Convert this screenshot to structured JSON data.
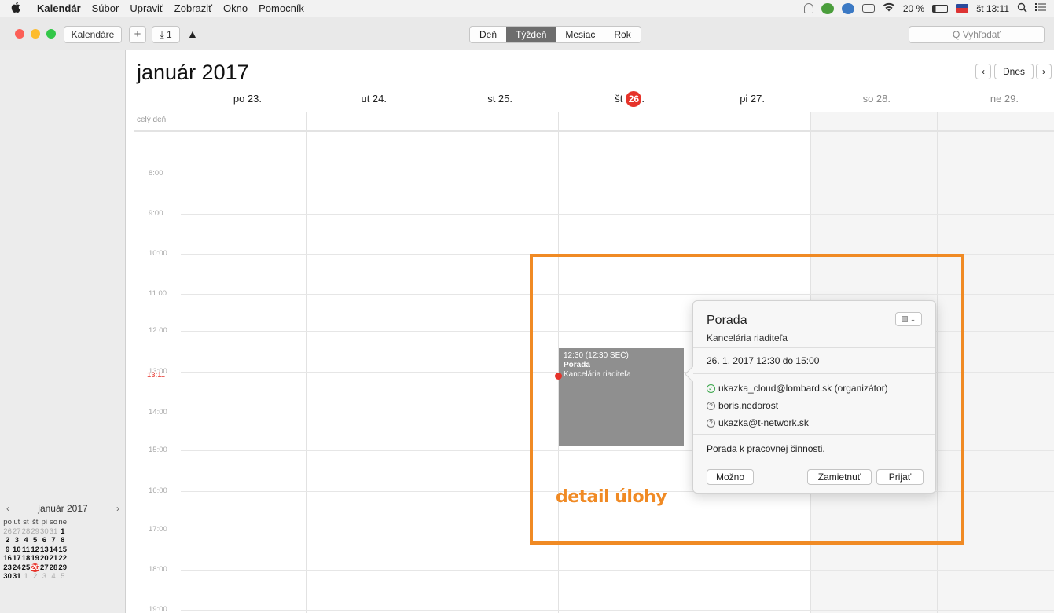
{
  "menubar": {
    "apple": "",
    "items": [
      "Kalendár",
      "Súbor",
      "Upraviť",
      "Zobraziť",
      "Okno",
      "Pomocník"
    ],
    "battery": "20 %",
    "clock": "št 13:11"
  },
  "toolbar": {
    "calendars_label": "Kalendáre",
    "add_label": "+",
    "inbox_label": "⤓ 1",
    "warning_label": "▲",
    "views": [
      "Deň",
      "Týždeň",
      "Mesiac",
      "Rok"
    ],
    "active_view": "Týždeň",
    "search_placeholder": "Q Vyhľadať"
  },
  "main": {
    "title": "január 2017",
    "today_label": "Dnes",
    "prev_label": "‹",
    "next_label": "›",
    "allday_label": "celý deň",
    "days": [
      {
        "label": "po 23."
      },
      {
        "label": "ut 24."
      },
      {
        "label": "st 25."
      },
      {
        "label": "št",
        "badge": "26",
        "suffix": "."
      },
      {
        "label": "pi 27."
      },
      {
        "label": "so 28."
      },
      {
        "label": "ne 29."
      }
    ],
    "hours": [
      "8:00",
      "9:00",
      "10:00",
      "11:00",
      "12:00",
      "13:00",
      "14:00",
      "15:00",
      "16:00",
      "17:00",
      "18:00",
      "19:00"
    ],
    "now_label": "13:11"
  },
  "event": {
    "time": "12:30 (12:30 SEČ)",
    "title": "Porada",
    "location": "Kancelária riaditeľa"
  },
  "popover": {
    "title": "Porada",
    "location": "Kancelária riaditeľa",
    "datetime": "26. 1. 2017  12:30 do 15:00",
    "attendees": [
      {
        "name": "ukazka_cloud@lombard.sk (organizátor)",
        "status": "accepted"
      },
      {
        "name": "boris.nedorost",
        "status": "unknown"
      },
      {
        "name": "ukazka@t-network.sk",
        "status": "unknown"
      }
    ],
    "notes": "Porada k pracovnej činnosti.",
    "maybe_label": "Možno",
    "decline_label": "Zamietnuť",
    "accept_label": "Prijať"
  },
  "annotation": {
    "label": "detail úlohy",
    "color": "#f08a24"
  },
  "mini_calendar": {
    "title": "január 2017",
    "prev": "‹",
    "next": "›",
    "weekdays": [
      "po",
      "ut",
      "st",
      "št",
      "pi",
      "so",
      "ne"
    ],
    "weeks": [
      [
        [
          "26",
          "o"
        ],
        [
          "27",
          "o"
        ],
        [
          "28",
          "o"
        ],
        [
          "29",
          "o"
        ],
        [
          "30",
          "o"
        ],
        [
          "31",
          "o"
        ],
        [
          "1",
          "c"
        ]
      ],
      [
        [
          "2",
          "c"
        ],
        [
          "3",
          "c"
        ],
        [
          "4",
          "c"
        ],
        [
          "5",
          "c"
        ],
        [
          "6",
          "c"
        ],
        [
          "7",
          "c"
        ],
        [
          "8",
          "c"
        ]
      ],
      [
        [
          "9",
          "c"
        ],
        [
          "10",
          "c"
        ],
        [
          "11",
          "c"
        ],
        [
          "12",
          "c"
        ],
        [
          "13",
          "c"
        ],
        [
          "14",
          "c"
        ],
        [
          "15",
          "c"
        ]
      ],
      [
        [
          "16",
          "c"
        ],
        [
          "17",
          "c"
        ],
        [
          "18",
          "c"
        ],
        [
          "19",
          "c"
        ],
        [
          "20",
          "c"
        ],
        [
          "21",
          "c"
        ],
        [
          "22",
          "c"
        ]
      ],
      [
        [
          "23",
          "c"
        ],
        [
          "24",
          "c"
        ],
        [
          "25",
          "c"
        ],
        [
          "26",
          "t"
        ],
        [
          "27",
          "c"
        ],
        [
          "28",
          "c"
        ],
        [
          "29",
          "c"
        ]
      ],
      [
        [
          "30",
          "c"
        ],
        [
          "31",
          "c"
        ],
        [
          "1",
          "o"
        ],
        [
          "2",
          "o"
        ],
        [
          "3",
          "o"
        ],
        [
          "4",
          "o"
        ],
        [
          "5",
          "o"
        ]
      ]
    ]
  },
  "colors": {
    "today_red": "#e6332a",
    "event_gray": "#8f8f8f",
    "active_segment": "#6d6d6d"
  }
}
